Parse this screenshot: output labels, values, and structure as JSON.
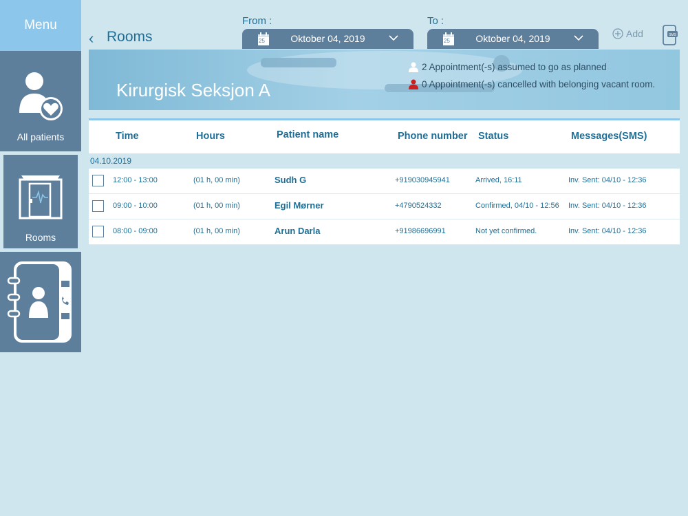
{
  "sidebar": {
    "menu_label": "Menu",
    "items": [
      {
        "label": "All patients"
      },
      {
        "label": "Rooms"
      },
      {
        "label": ""
      }
    ]
  },
  "header": {
    "back_label": "Rooms",
    "from_label": "From :",
    "to_label": "To :",
    "from_date": "Oktober 04, 2019",
    "to_date": "Oktober 04, 2019",
    "calendar_day": "25",
    "add_label": "Add",
    "sms_icon_text": "SMS"
  },
  "banner": {
    "title": "Kirurgisk Seksjon A",
    "stat_planned": "2 Appointment(-s) assumed to go as planned",
    "stat_cancelled": "0 Appointment(-s) cancelled with belonging vacant room."
  },
  "table": {
    "columns": [
      "Time",
      "Hours",
      "Patient name",
      "Phone number",
      "Status",
      "Messages(SMS)"
    ],
    "group_date": "04.10.2019",
    "rows": [
      {
        "time": "12:00 - 13:00",
        "hours": "(01 h, 00 min)",
        "name": "Sudh G",
        "phone": "+919030945941",
        "status": "Arrived, 16:11",
        "sms": "Inv. Sent: 04/10 - 12:36"
      },
      {
        "time": "09:00 - 10:00",
        "hours": "(01 h, 00 min)",
        "name": "Egil Mørner",
        "phone": "+4790524332",
        "status": "Confirmed, 04/10 - 12:56",
        "sms": "Inv. Sent: 04/10 - 12:36"
      },
      {
        "time": "08:00 - 09:00",
        "hours": "(01 h, 00 min)",
        "name": "Arun Darla",
        "phone": "+91986696991",
        "status": "Not yet confirmed.",
        "sms": "Inv. Sent: 04/10 - 12:36"
      }
    ]
  },
  "colors": {
    "accent": "#1e6f97",
    "sidebar": "#5e7f9c",
    "menu": "#8cc6ea",
    "background": "#cfe6ef",
    "cancel_icon": "#cc1f1f"
  }
}
